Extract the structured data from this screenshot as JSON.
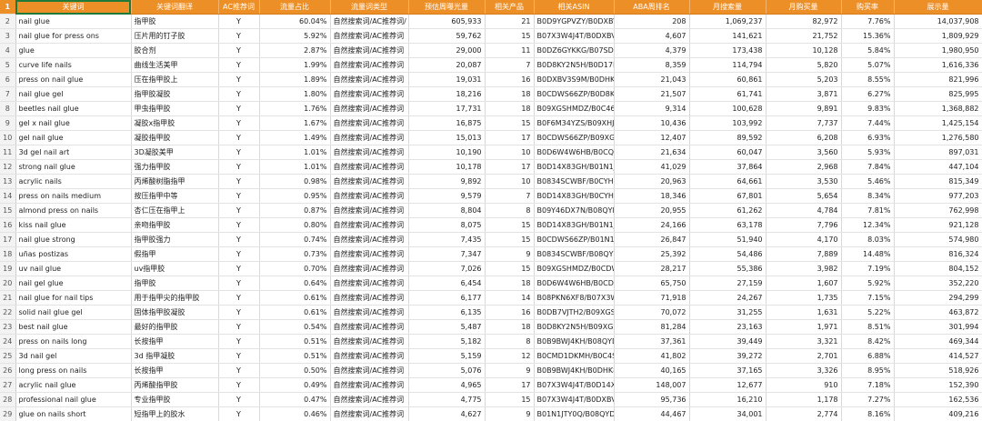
{
  "colors": {
    "header_bg": "#ed8f27",
    "header_text": "#ffffff",
    "selection": "#1e7b3a",
    "rownum_bg": "#f3f3f3"
  },
  "header_row_number": "1",
  "columns": [
    "关键词",
    "关键词翻译",
    "AC推荐词",
    "流量占比",
    "流量词类型",
    "预估周曝光量",
    "相关产品",
    "相关ASIN",
    "ABA周排名",
    "月搜索量",
    "月购买量",
    "购买率",
    "展示量"
  ],
  "rows": [
    {
      "n": "2",
      "c": [
        "nail glue",
        "指甲胶",
        "Y",
        "60.04%",
        "自然搜索词/AC推荐词/",
        "605,933",
        "21",
        "B0D9YGPVZY/B0DXBV3",
        "208",
        "1,069,237",
        "82,972",
        "7.76%",
        "14,037,908"
      ]
    },
    {
      "n": "3",
      "c": [
        "nail glue for press ons",
        "压片用的钉子胶",
        "Y",
        "5.92%",
        "自然搜索词/AC推荐词",
        "59,762",
        "15",
        "B07X3W4J4T/B0DXBV2f",
        "4,607",
        "141,621",
        "21,752",
        "15.36%",
        "1,809,929"
      ]
    },
    {
      "n": "4",
      "c": [
        "glue",
        "胶合剂",
        "Y",
        "2.87%",
        "自然搜索词/AC推荐词",
        "29,000",
        "11",
        "B0DZ6GYKKG/B07SD83",
        "4,379",
        "173,438",
        "10,128",
        "5.84%",
        "1,980,950"
      ]
    },
    {
      "n": "5",
      "c": [
        "curve life nails",
        "曲线生活美甲",
        "Y",
        "1.99%",
        "自然搜索词/AC推荐词",
        "20,087",
        "7",
        "B0D8KY2N5H/B0D17PC",
        "8,359",
        "114,794",
        "5,820",
        "5.07%",
        "1,616,336"
      ]
    },
    {
      "n": "6",
      "c": [
        "press on nail glue",
        "压在指甲胶上",
        "Y",
        "1.89%",
        "自然搜索词/AC推荐词",
        "19,031",
        "16",
        "B0DXBV3S9M/B0DHK8",
        "21,043",
        "60,861",
        "5,203",
        "8.55%",
        "821,996"
      ]
    },
    {
      "n": "7",
      "c": [
        "nail glue gel",
        "指甲胶凝胶",
        "Y",
        "1.80%",
        "自然搜索词/AC推荐词",
        "18,216",
        "18",
        "B0CDWS66ZP/B0D8KY2",
        "21,507",
        "61,741",
        "3,871",
        "6.27%",
        "825,995"
      ]
    },
    {
      "n": "8",
      "c": [
        "beetles nail glue",
        "甲虫指甲胶",
        "Y",
        "1.76%",
        "自然搜索词/AC推荐词",
        "17,731",
        "18",
        "B09XGSHMDZ/B0C46X",
        "9,314",
        "100,628",
        "9,891",
        "9.83%",
        "1,368,882"
      ]
    },
    {
      "n": "9",
      "c": [
        "gel x nail glue",
        "凝胶x指甲胶",
        "Y",
        "1.67%",
        "自然搜索词/AC推荐词",
        "16,875",
        "15",
        "B0F6M34YZS/B09XHJ1C",
        "10,436",
        "103,992",
        "7,737",
        "7.44%",
        "1,425,154"
      ]
    },
    {
      "n": "10",
      "c": [
        "gel nail glue",
        "凝胶指甲胶",
        "Y",
        "1.49%",
        "自然搜索词/AC推荐词",
        "15,013",
        "17",
        "B0CDWS66ZP/B09XGSH",
        "12,407",
        "89,592",
        "6,208",
        "6.93%",
        "1,276,580"
      ]
    },
    {
      "n": "11",
      "c": [
        "3d gel nail art",
        "3D凝胶美甲",
        "Y",
        "1.01%",
        "自然搜索词/AC推荐词",
        "10,190",
        "10",
        "B0D6W4W6HB/B0CQY2",
        "21,634",
        "60,047",
        "3,560",
        "5.93%",
        "897,031"
      ]
    },
    {
      "n": "12",
      "c": [
        "strong nail glue",
        "强力指甲胶",
        "Y",
        "1.01%",
        "自然搜索词/AC推荐词",
        "10,178",
        "17",
        "B0D14X83GH/B01N1JT",
        "41,029",
        "37,864",
        "2,968",
        "7.84%",
        "447,104"
      ]
    },
    {
      "n": "13",
      "c": [
        "acrylic nails",
        "丙烯酸树脂指甲",
        "Y",
        "0.98%",
        "自然搜索词/AC推荐词",
        "9,892",
        "10",
        "B0834SCWBF/B0CYH7V",
        "20,963",
        "64,661",
        "3,530",
        "5.46%",
        "815,349"
      ]
    },
    {
      "n": "14",
      "c": [
        "press on nails medium",
        "按压指甲中等",
        "Y",
        "0.95%",
        "自然搜索词/AC推荐词",
        "9,579",
        "7",
        "B0D14X83GH/B0CYH7V",
        "18,346",
        "67,801",
        "5,654",
        "8.34%",
        "977,203"
      ]
    },
    {
      "n": "15",
      "c": [
        "almond press on nails",
        "杏仁压在指甲上",
        "Y",
        "0.87%",
        "自然搜索词/AC推荐词",
        "8,804",
        "8",
        "B09Y46DX7N/B08QYD4",
        "20,955",
        "61,262",
        "4,784",
        "7.81%",
        "762,998"
      ]
    },
    {
      "n": "16",
      "c": [
        "kiss nail glue",
        "亲吻指甲胶",
        "Y",
        "0.80%",
        "自然搜索词/AC推荐词",
        "8,075",
        "15",
        "B0D14X83GH/B01N1JT",
        "24,166",
        "63,178",
        "7,796",
        "12.34%",
        "921,128"
      ]
    },
    {
      "n": "17",
      "c": [
        "nail glue strong",
        "指甲胶强力",
        "Y",
        "0.74%",
        "自然搜索词/AC推荐词",
        "7,435",
        "15",
        "B0CDWS66ZP/B01N1JT",
        "26,847",
        "51,940",
        "4,170",
        "8.03%",
        "574,980"
      ]
    },
    {
      "n": "18",
      "c": [
        "uñas postizas",
        "假指甲",
        "Y",
        "0.73%",
        "自然搜索词/AC推荐词",
        "7,347",
        "9",
        "B0834SCWBF/B08QYD4",
        "25,392",
        "54,486",
        "7,889",
        "14.48%",
        "816,324"
      ]
    },
    {
      "n": "19",
      "c": [
        "uv nail glue",
        "uv指甲胶",
        "Y",
        "0.70%",
        "自然搜索词/AC推荐词",
        "7,026",
        "15",
        "B09XGSHMDZ/B0CDWS",
        "28,217",
        "55,386",
        "3,982",
        "7.19%",
        "804,152"
      ]
    },
    {
      "n": "20",
      "c": [
        "nail gel glue",
        "指甲胶",
        "Y",
        "0.64%",
        "自然搜索词/AC推荐词",
        "6,454",
        "18",
        "B0D6W4W6HB/B0CDW",
        "65,750",
        "27,159",
        "1,607",
        "5.92%",
        "352,220"
      ]
    },
    {
      "n": "21",
      "c": [
        "nail glue for nail tips",
        "用于指甲尖的指甲胶",
        "Y",
        "0.61%",
        "自然搜索词/AC推荐词",
        "6,177",
        "14",
        "B08PKN6XF8/B07X3W4",
        "71,918",
        "24,267",
        "1,735",
        "7.15%",
        "294,299"
      ]
    },
    {
      "n": "22",
      "c": [
        "solid nail glue gel",
        "固体指甲胶凝胶",
        "Y",
        "0.61%",
        "自然搜索词/AC推荐词",
        "6,135",
        "16",
        "B0DB7VJTH2/B09XGSH",
        "70,072",
        "31,255",
        "1,631",
        "5.22%",
        "463,872"
      ]
    },
    {
      "n": "23",
      "c": [
        "best nail glue",
        "最好的指甲胶",
        "Y",
        "0.54%",
        "自然搜索词/AC推荐词",
        "5,487",
        "18",
        "B0D8KY2N5H/B09XGSH",
        "81,284",
        "23,163",
        "1,971",
        "8.51%",
        "301,994"
      ]
    },
    {
      "n": "24",
      "c": [
        "press on nails long",
        "长按指甲",
        "Y",
        "0.51%",
        "自然搜索词/AC推荐词",
        "5,182",
        "8",
        "B0B9BWJ4KH/B08QYD4",
        "37,361",
        "39,449",
        "3,321",
        "8.42%",
        "469,344"
      ]
    },
    {
      "n": "25",
      "c": [
        "3d nail gel",
        "3d 指甲凝胶",
        "Y",
        "0.51%",
        "自然搜索词/AC推荐词",
        "5,159",
        "12",
        "B0CMD1DKMH/B0C4SF",
        "41,802",
        "39,272",
        "2,701",
        "6.88%",
        "414,527"
      ]
    },
    {
      "n": "26",
      "c": [
        "long press on nails",
        "长按指甲",
        "Y",
        "0.50%",
        "自然搜索词/AC推荐词",
        "5,076",
        "9",
        "B0B9BWJ4KH/B0DHK8C",
        "40,165",
        "37,165",
        "3,326",
        "8.95%",
        "518,926"
      ]
    },
    {
      "n": "27",
      "c": [
        "acrylic nail glue",
        "丙烯酸指甲胶",
        "Y",
        "0.49%",
        "自然搜索词/AC推荐词",
        "4,965",
        "17",
        "B07X3W4J4T/B0D14X8",
        "148,007",
        "12,677",
        "910",
        "7.18%",
        "152,390"
      ]
    },
    {
      "n": "28",
      "c": [
        "professional nail glue",
        "专业指甲胶",
        "Y",
        "0.47%",
        "自然搜索词/AC推荐词",
        "4,775",
        "15",
        "B07X3W4J4T/B0DXBV3",
        "95,736",
        "16,210",
        "1,178",
        "7.27%",
        "162,536"
      ]
    },
    {
      "n": "29",
      "c": [
        "glue on nails short",
        "短指甲上的胶水",
        "Y",
        "0.46%",
        "自然搜索词/AC推荐词",
        "4,627",
        "9",
        "B01N1JTY0Q/B08QYD4",
        "44,467",
        "34,001",
        "2,774",
        "8.16%",
        "409,216"
      ]
    },
    {
      "n": "30",
      "c": [
        "super strong nail glue",
        "超强力指甲胶",
        "Y",
        "0.45%",
        "自然搜索词/AC推荐词",
        "4,565",
        "16",
        "B0DZ6GYKKG/B08PKN6",
        "99,000",
        "18,852",
        "1,785",
        "9.47%",
        "239,337"
      ]
    }
  ]
}
